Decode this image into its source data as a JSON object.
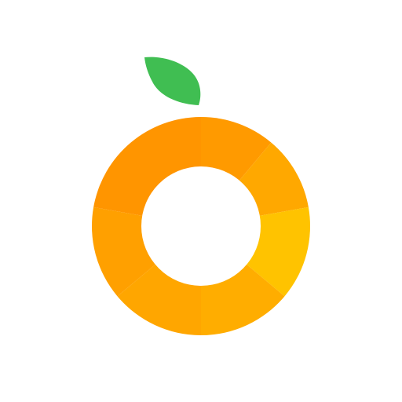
{
  "logo": {
    "icon_name": "orange-fruit-logo-icon",
    "background_color": "#ffffff",
    "leaf_color": "#40be52",
    "hole_color": "#ffffff",
    "segment_colors": [
      "#ff9a00",
      "#ffa800",
      "#ffc300",
      "#ffad00",
      "#ffa600",
      "#ffa000",
      "#ff9500",
      "#ff6f00"
    ]
  }
}
